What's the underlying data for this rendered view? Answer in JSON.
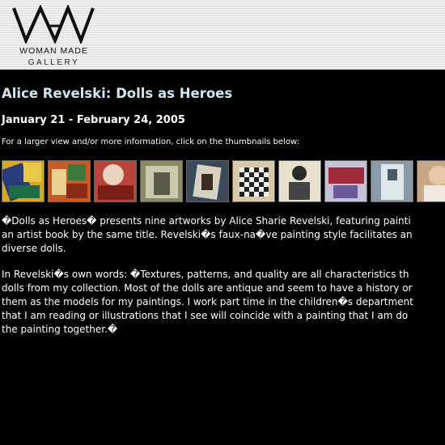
{
  "header": {
    "logo_name": "WOMAN MADE",
    "logo_sub": "GALLERY"
  },
  "exhibit": {
    "title": "Alice Revelski: Dolls as Heroes",
    "dates": "January 21 - February 24, 2005",
    "instructions": "For a larger view and/or more information, click on the thumbnails below:"
  },
  "thumbnails": [
    {
      "alt": "thumbnail-1"
    },
    {
      "alt": "thumbnail-2"
    },
    {
      "alt": "thumbnail-3"
    },
    {
      "alt": "thumbnail-4"
    },
    {
      "alt": "thumbnail-5"
    },
    {
      "alt": "thumbnail-6"
    },
    {
      "alt": "thumbnail-7"
    },
    {
      "alt": "thumbnail-8"
    },
    {
      "alt": "thumbnail-9"
    },
    {
      "alt": "thumbnail-10"
    }
  ],
  "description": {
    "p1": [
      "�Dolls as Heroes� presents nine artworks by Alice Sharie Revelski, featuring painti",
      "an artist book by the same title. Revelski�s faux-na�ve painting style facilitates an",
      "diverse dolls."
    ],
    "p2": [
      "In Revelski�s own words: �Textures, patterns, and quality are all characteristics th",
      "dolls from my collection. Most of the dolls are antique and seem to have a history or",
      "them as the models for my paintings. I work part time in the children�s department",
      "that I am reading or illustrations that I see will coincide with a painting that I am do",
      "the painting together.�"
    ]
  }
}
